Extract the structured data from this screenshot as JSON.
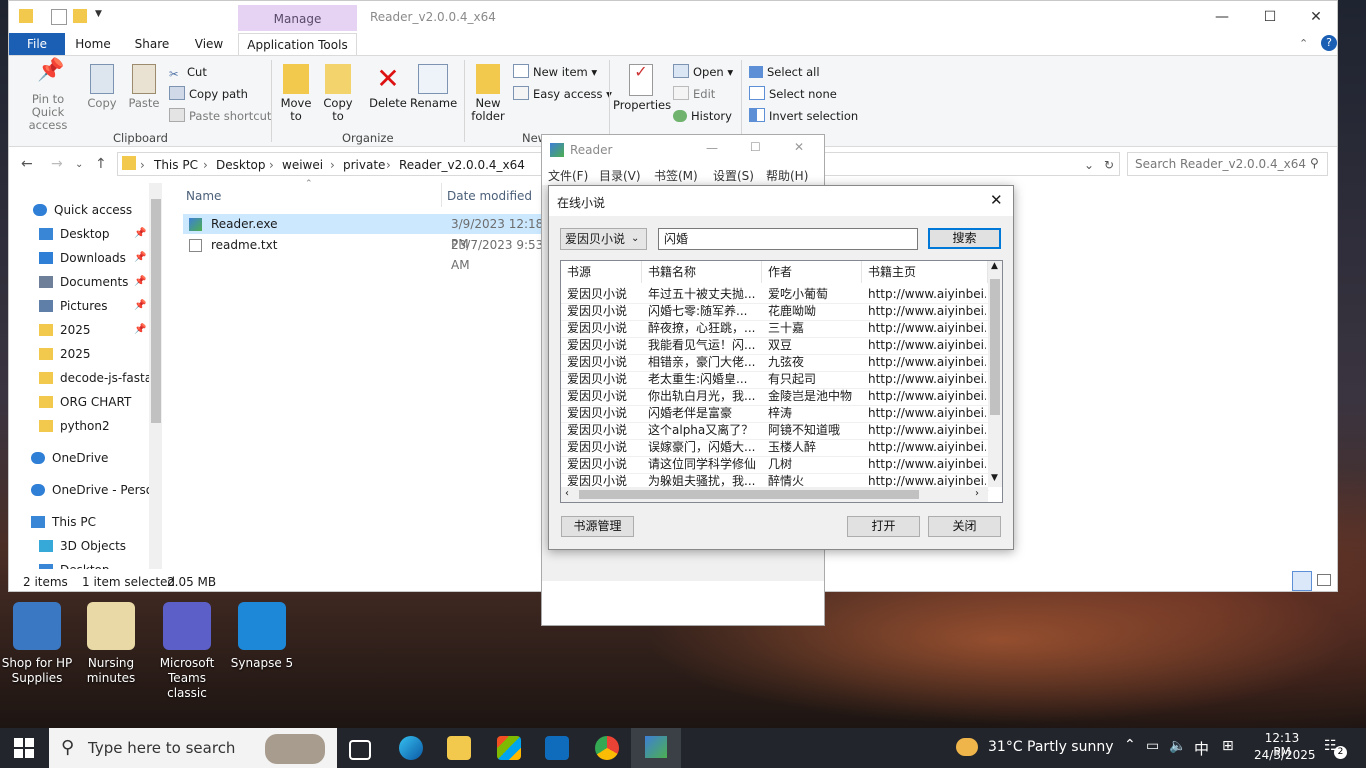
{
  "explorer": {
    "title": "Reader_v2.0.0.4_x64",
    "contextual_tab": "Manage",
    "tabs": [
      "File",
      "Home",
      "Share",
      "View",
      "Application Tools"
    ],
    "ribbon": {
      "pin": "Pin to Quick access",
      "copy": "Copy",
      "paste": "Paste",
      "cut": "Cut",
      "copy_path": "Copy path",
      "paste_shortcut": "Paste shortcut",
      "clipboard": "Clipboard",
      "move_to": "Move to",
      "copy_to": "Copy to",
      "delete": "Delete",
      "rename": "Rename",
      "organize": "Organize",
      "new_folder": "New folder",
      "new_item": "New item",
      "easy_access": "Easy access",
      "new_group": "New",
      "properties": "Properties",
      "open": "Open",
      "edit": "Edit",
      "history": "History",
      "select_all": "Select all",
      "select_none": "Select none",
      "invert_selection": "Invert selection"
    },
    "breadcrumb": [
      "This PC",
      "Desktop",
      "weiwei",
      "private",
      "Reader_v2.0.0.4_x64"
    ],
    "search_placeholder": "Search Reader_v2.0.0.4_x64",
    "nav": [
      {
        "label": "Quick access",
        "icon": "star-icon"
      },
      {
        "label": "Desktop",
        "icon": "desktop-icon",
        "pinned": true
      },
      {
        "label": "Downloads",
        "icon": "download-icon",
        "pinned": true
      },
      {
        "label": "Documents",
        "icon": "documents-icon",
        "pinned": true
      },
      {
        "label": "Pictures",
        "icon": "pictures-icon",
        "pinned": true
      },
      {
        "label": "2025",
        "icon": "folder-icon",
        "pinned": true
      },
      {
        "label": "2025",
        "icon": "folder-icon"
      },
      {
        "label": "decode-js-fastap",
        "icon": "folder-icon"
      },
      {
        "label": "ORG CHART",
        "icon": "folder-icon"
      },
      {
        "label": "python2",
        "icon": "folder-icon"
      },
      {
        "label": "OneDrive",
        "icon": "cloud-icon"
      },
      {
        "label": "OneDrive - Persor",
        "icon": "cloud-icon"
      },
      {
        "label": "This PC",
        "icon": "pc-icon"
      },
      {
        "label": "3D Objects",
        "icon": "cube-icon"
      },
      {
        "label": "Desktop",
        "icon": "desktop-icon"
      }
    ],
    "columns": {
      "name": "Name",
      "date": "Date modified"
    },
    "files": [
      {
        "name": "Reader.exe",
        "date": "3/9/2023 12:18 PM",
        "selected": true
      },
      {
        "name": "readme.txt",
        "date": "23/7/2023 9:53 AM",
        "selected": false
      }
    ],
    "status": {
      "items": "2 items",
      "selected": "1 item selected",
      "size": "2.05 MB"
    }
  },
  "reader": {
    "title": "Reader",
    "menu": [
      "文件(F)",
      "目录(V)",
      "书签(M)",
      "设置(S)",
      "帮助(H)"
    ]
  },
  "dialog": {
    "title": "在线小说",
    "source": "爱因贝小说",
    "query": "闪婚",
    "search_button": "搜索",
    "columns": [
      "书源",
      "书籍名称",
      "作者",
      "书籍主页"
    ],
    "rows": [
      [
        "爱因贝小说",
        "年过五十被丈夫抛...",
        "爱吃小葡萄",
        "http://www.aiyinbei.com"
      ],
      [
        "爱因贝小说",
        "闪婚七零:随军养...",
        "花鹿呦呦",
        "http://www.aiyinbei.com"
      ],
      [
        "爱因贝小说",
        "醉夜撩，心狂跳，...",
        "三十嘉",
        "http://www.aiyinbei.com"
      ],
      [
        "爱因贝小说",
        "我能看见气运！闪...",
        "双豆",
        "http://www.aiyinbei.com"
      ],
      [
        "爱因贝小说",
        "相错亲，豪门大佬...",
        "九弦夜",
        "http://www.aiyinbei.com"
      ],
      [
        "爱因贝小说",
        "老太重生:闪婚皇...",
        "有只起司",
        "http://www.aiyinbei.com"
      ],
      [
        "爱因贝小说",
        "你出轨白月光，我...",
        "金陵岂是池中物",
        "http://www.aiyinbei.com"
      ],
      [
        "爱因贝小说",
        "闪婚老伴是富豪",
        "梓涛",
        "http://www.aiyinbei.com"
      ],
      [
        "爱因贝小说",
        "这个alpha又离了？",
        "阿镜不知道哦",
        "http://www.aiyinbei.com"
      ],
      [
        "爱因贝小说",
        "误嫁豪门，闪婚大...",
        "玉楼人醉",
        "http://www.aiyinbei.com"
      ],
      [
        "爱因贝小说",
        "请这位同学科学修仙",
        "几树",
        "http://www.aiyinbei.com"
      ],
      [
        "爱因贝小说",
        "为躲姐夫骚扰，我...",
        "醉情火",
        "http://www.aiyinbei.com"
      ]
    ],
    "source_manage": "书源管理",
    "open": "打开",
    "close": "关闭"
  },
  "desktop": [
    {
      "label": "Shop for HP Supplies",
      "color": "#3a78c4"
    },
    {
      "label": "Nursing minutes",
      "color": "#e8d9a6"
    },
    {
      "label": "Microsoft Teams classic",
      "color": "#5b5fc7"
    },
    {
      "label": "Synapse 5",
      "color": "#1e88d8"
    }
  ],
  "taskbar": {
    "search_placeholder": "Type here to search",
    "weather": "31°C  Partly sunny",
    "ime": "中",
    "time": "12:13 PM",
    "date": "24/3/2025",
    "notifications": "2"
  },
  "colors": {
    "accent": "#1a5fb4",
    "manage": "#e6d3f3",
    "selected_row": "#cce8ff",
    "taskbar": "#22252b"
  }
}
